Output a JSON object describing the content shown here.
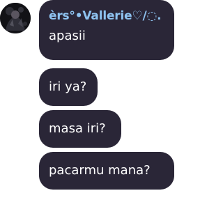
{
  "chat": {
    "sender_name": "èrs°•Vallerie♡/◌.",
    "messages": [
      {
        "text": "apasii"
      },
      {
        "text": "iri ya?"
      },
      {
        "text": "masa iri?"
      },
      {
        "text": "pacarmu mana?"
      }
    ]
  },
  "colors": {
    "bubble": "#2a2637",
    "sender_name": "#8ec3f0",
    "message_text": "#ffffff",
    "background": "#ffffff"
  },
  "icons": {
    "avatar": "profile-photo"
  }
}
